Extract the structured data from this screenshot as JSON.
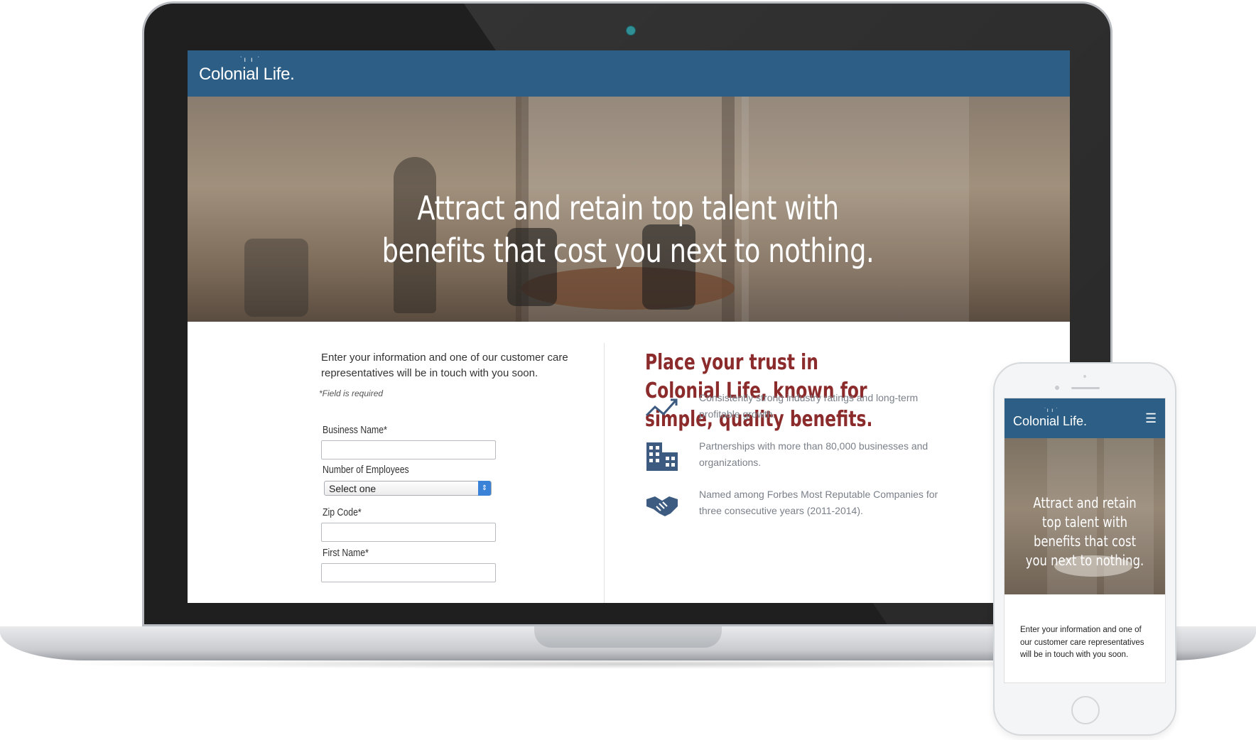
{
  "site": {
    "brand": "Colonial Life.",
    "hero_title": "Attract and retain top talent with benefits that cost you next to nothing."
  },
  "form": {
    "intro": "Enter your information and one of our customer care representatives will be in touch with you soon.",
    "required_note": "*Field is required",
    "fields": [
      {
        "label": "Business Name*",
        "value": ""
      },
      {
        "label": "Number of Employees",
        "value": "Select one"
      },
      {
        "label": "Zip Code*",
        "value": ""
      },
      {
        "label": "First Name*",
        "value": ""
      }
    ]
  },
  "trust": {
    "title": "Place your trust in Colonial Life, known for simple, quality benefits.",
    "features": [
      {
        "icon": "trend-up-icon",
        "text": "Consistently strong industry ratings and long-term profitable growth."
      },
      {
        "icon": "building-icon",
        "text": "Partnerships with more than 80,000 businesses and organizations."
      },
      {
        "icon": "handshake-icon",
        "text": "Named among Forbes Most Reputable Companies for three consecutive years (2011-2014)."
      }
    ]
  },
  "mobile": {
    "brand": "Colonial Life.",
    "menu_icon": "hamburger-menu-icon",
    "hero_title": "Attract and retain top talent with benefits that cost you next to nothing.",
    "intro": "Enter your information and one of our customer care representatives will be in touch with you soon."
  },
  "colors": {
    "header_blue": "#2d5f86",
    "trust_title": "#8b2b2b",
    "icon_blue": "#3d5a80"
  }
}
